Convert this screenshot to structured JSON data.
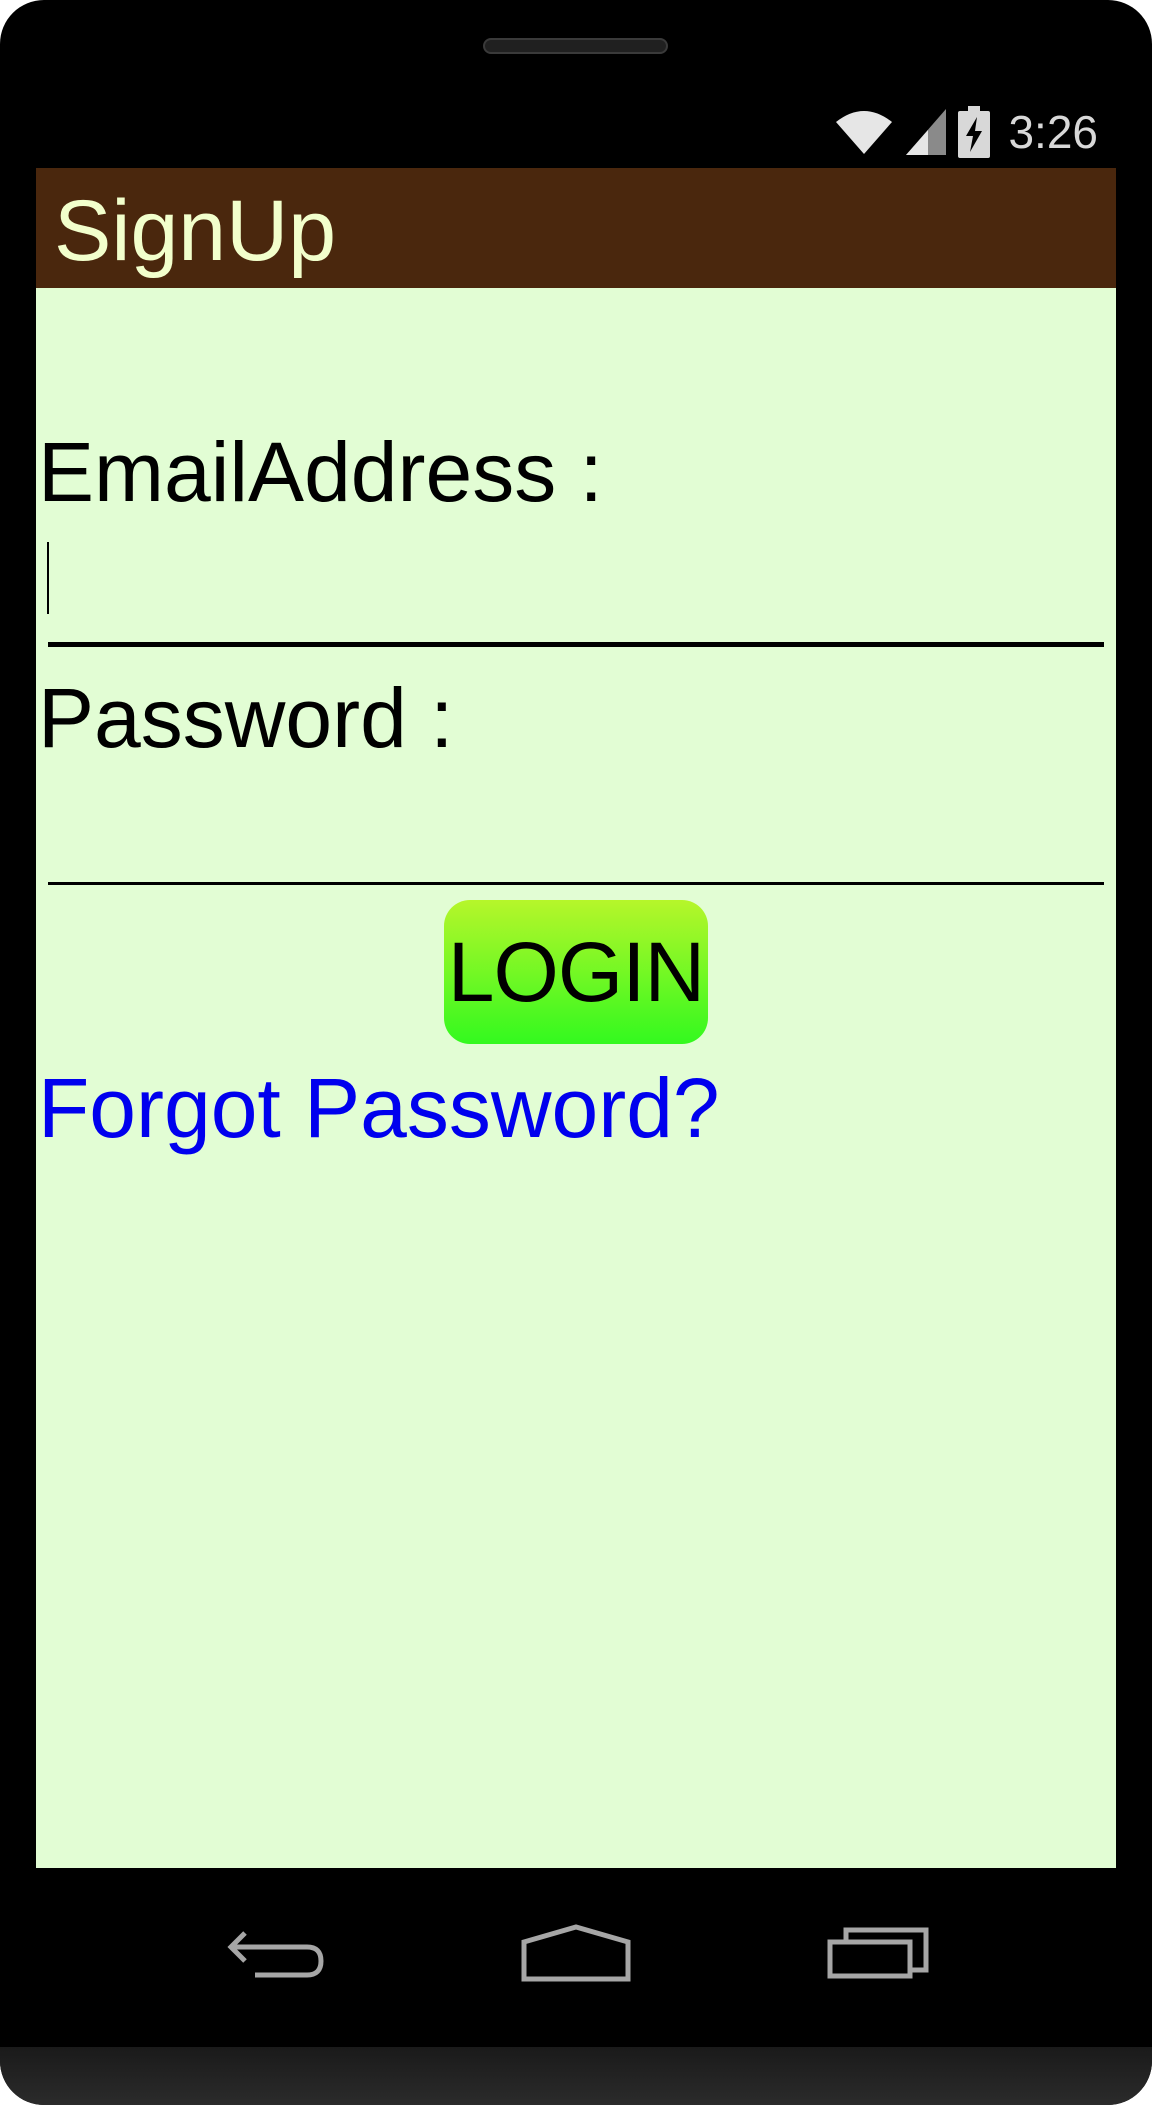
{
  "status_bar": {
    "time": "3:26",
    "icons": [
      "wifi-icon",
      "cellular-signal-icon",
      "battery-charging-icon"
    ]
  },
  "app_bar": {
    "title": "SignUp",
    "background_color": "#4a270d",
    "title_color": "#f2ffcc"
  },
  "form": {
    "email_label": "EmailAddress :",
    "email_value": "",
    "password_label": "Password :",
    "password_value": "",
    "login_label": "LOGIN",
    "forgot_password": "Forgot Password?",
    "screen_background": "#e2fdd4",
    "login_gradient": [
      "#b6f62a",
      "#33f91f"
    ],
    "link_color": "#0000ee"
  },
  "navigation": {
    "icons": [
      "back-icon",
      "home-icon",
      "recent-apps-icon"
    ]
  }
}
